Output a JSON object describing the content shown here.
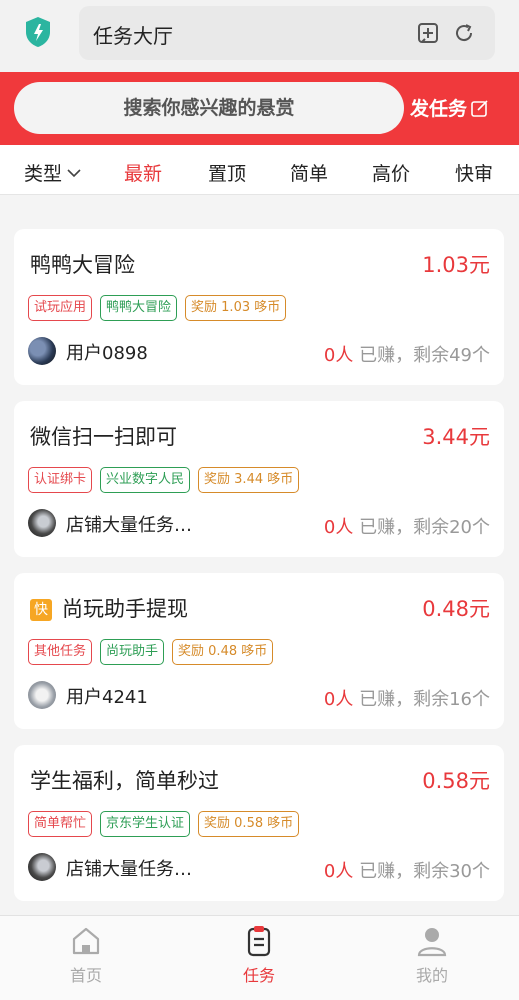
{
  "header": {
    "title": "任务大厅"
  },
  "search": {
    "placeholder": "搜索你感兴趣的悬赏",
    "publish_label": "发任务"
  },
  "tabs": [
    {
      "label": "类型"
    },
    {
      "label": "最新",
      "active": true
    },
    {
      "label": "置顶"
    },
    {
      "label": "简单"
    },
    {
      "label": "高价"
    },
    {
      "label": "快审"
    }
  ],
  "tasks": [
    {
      "title": "鸭鸭大冒险",
      "price": "1.03元",
      "tags": [
        "试玩应用",
        "鸭鸭大冒险",
        "奖励 1.03 哆币"
      ],
      "user": "用户0898",
      "earned": "0人",
      "earned_suffix": "已赚，剩余49个"
    },
    {
      "title": "微信扫一扫即可",
      "price": "3.44元",
      "tags": [
        "认证绑卡",
        "兴业数字人民",
        "奖励 3.44 哆币"
      ],
      "user": "店铺大量任务…",
      "earned": "0人",
      "earned_suffix": "已赚，剩余20个"
    },
    {
      "badge": "快",
      "title": "尚玩助手提现",
      "price": "0.48元",
      "tags": [
        "其他任务",
        "尚玩助手",
        "奖励 0.48 哆币"
      ],
      "user": "用户4241",
      "earned": "0人",
      "earned_suffix": "已赚，剩余16个"
    },
    {
      "title": "学生福利，简单秒过",
      "price": "0.58元",
      "tags": [
        "简单帮忙",
        "京东学生认证",
        "奖励 0.58 哆币"
      ],
      "user": "店铺大量任务…",
      "earned": "0人",
      "earned_suffix": "已赚，剩余30个"
    }
  ],
  "nav": [
    {
      "label": "首页",
      "icon": "home-icon"
    },
    {
      "label": "任务",
      "icon": "task-icon",
      "active": true
    },
    {
      "label": "我的",
      "icon": "profile-icon"
    }
  ],
  "colors": {
    "accent": "#f0393c",
    "tag_red": "#e5484d",
    "tag_green": "#2e9e55",
    "tag_orange": "#d68b2a"
  }
}
